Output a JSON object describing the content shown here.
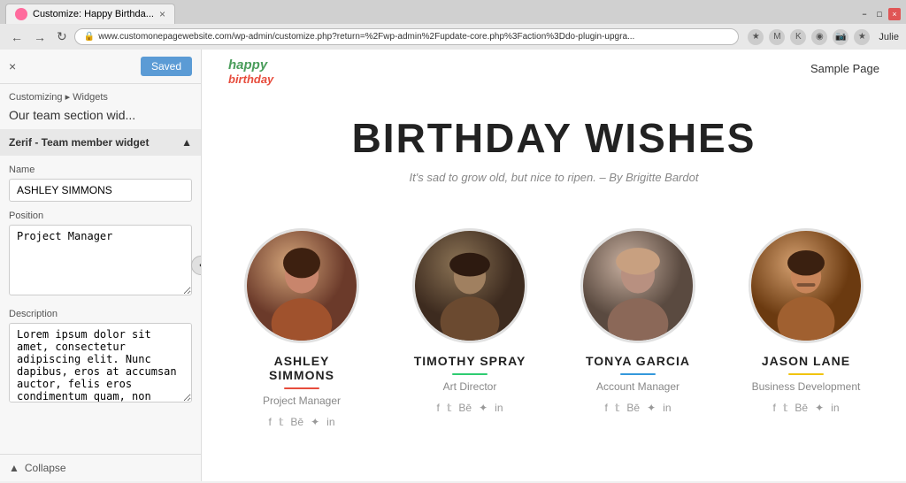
{
  "browser": {
    "tab_title": "Customize: Happy Birthda...",
    "url": "www.customonepagewebsite.com/wp-admin/customize.php?return=%2Fwp-admin%2Fupdate-core.php%3Faction%3Ddo-plugin-upgra...",
    "user": "Julie",
    "close_label": "×",
    "minimize_label": "−",
    "maximize_label": "□"
  },
  "sidebar": {
    "close_icon": "×",
    "saved_label": "Saved",
    "breadcrumb": "Customizing ▸ Widgets",
    "section_title": "Our team section wid...",
    "widget_title": "Zerif - Team member widget",
    "name_label": "Name",
    "name_value": "ASHLEY SIMMONS",
    "position_label": "Position",
    "position_value": "Project Manager",
    "description_label": "Description",
    "description_value": "Lorem ipsum dolor sit amet, consectetur adipiscing elit. Nunc dapibus, eros at accumsan auctor, felis eros condimentum quam, non porttitor est urna vel neque",
    "collapse_label": "Collapse"
  },
  "preview": {
    "nav_link": "Sample Page",
    "logo_happy": "happy",
    "logo_birthday": "birthday",
    "hero_title": "BIRTHDAY WISHES",
    "hero_subtitle": "It's sad to grow old, but nice to ripen. – By Brigitte Bardot",
    "team_members": [
      {
        "name": "ASHLEY SIMMONS",
        "position": "Project Manager",
        "divider_color": "divider-red",
        "avatar_class": "avatar-ashley",
        "avatar_emoji": "👩"
      },
      {
        "name": "TIMOTHY SPRAY",
        "position": "Art Director",
        "divider_color": "divider-green",
        "avatar_class": "avatar-timothy",
        "avatar_emoji": "👨"
      },
      {
        "name": "TONYA GARCIA",
        "position": "Account Manager",
        "divider_color": "divider-blue",
        "avatar_class": "avatar-tonya",
        "avatar_emoji": "👩"
      },
      {
        "name": "JASON LANE",
        "position": "Business Development",
        "divider_color": "divider-yellow",
        "avatar_class": "avatar-jason",
        "avatar_emoji": "👨"
      }
    ],
    "social_icons": [
      "f",
      "t",
      "Be",
      "✦",
      "in"
    ]
  }
}
